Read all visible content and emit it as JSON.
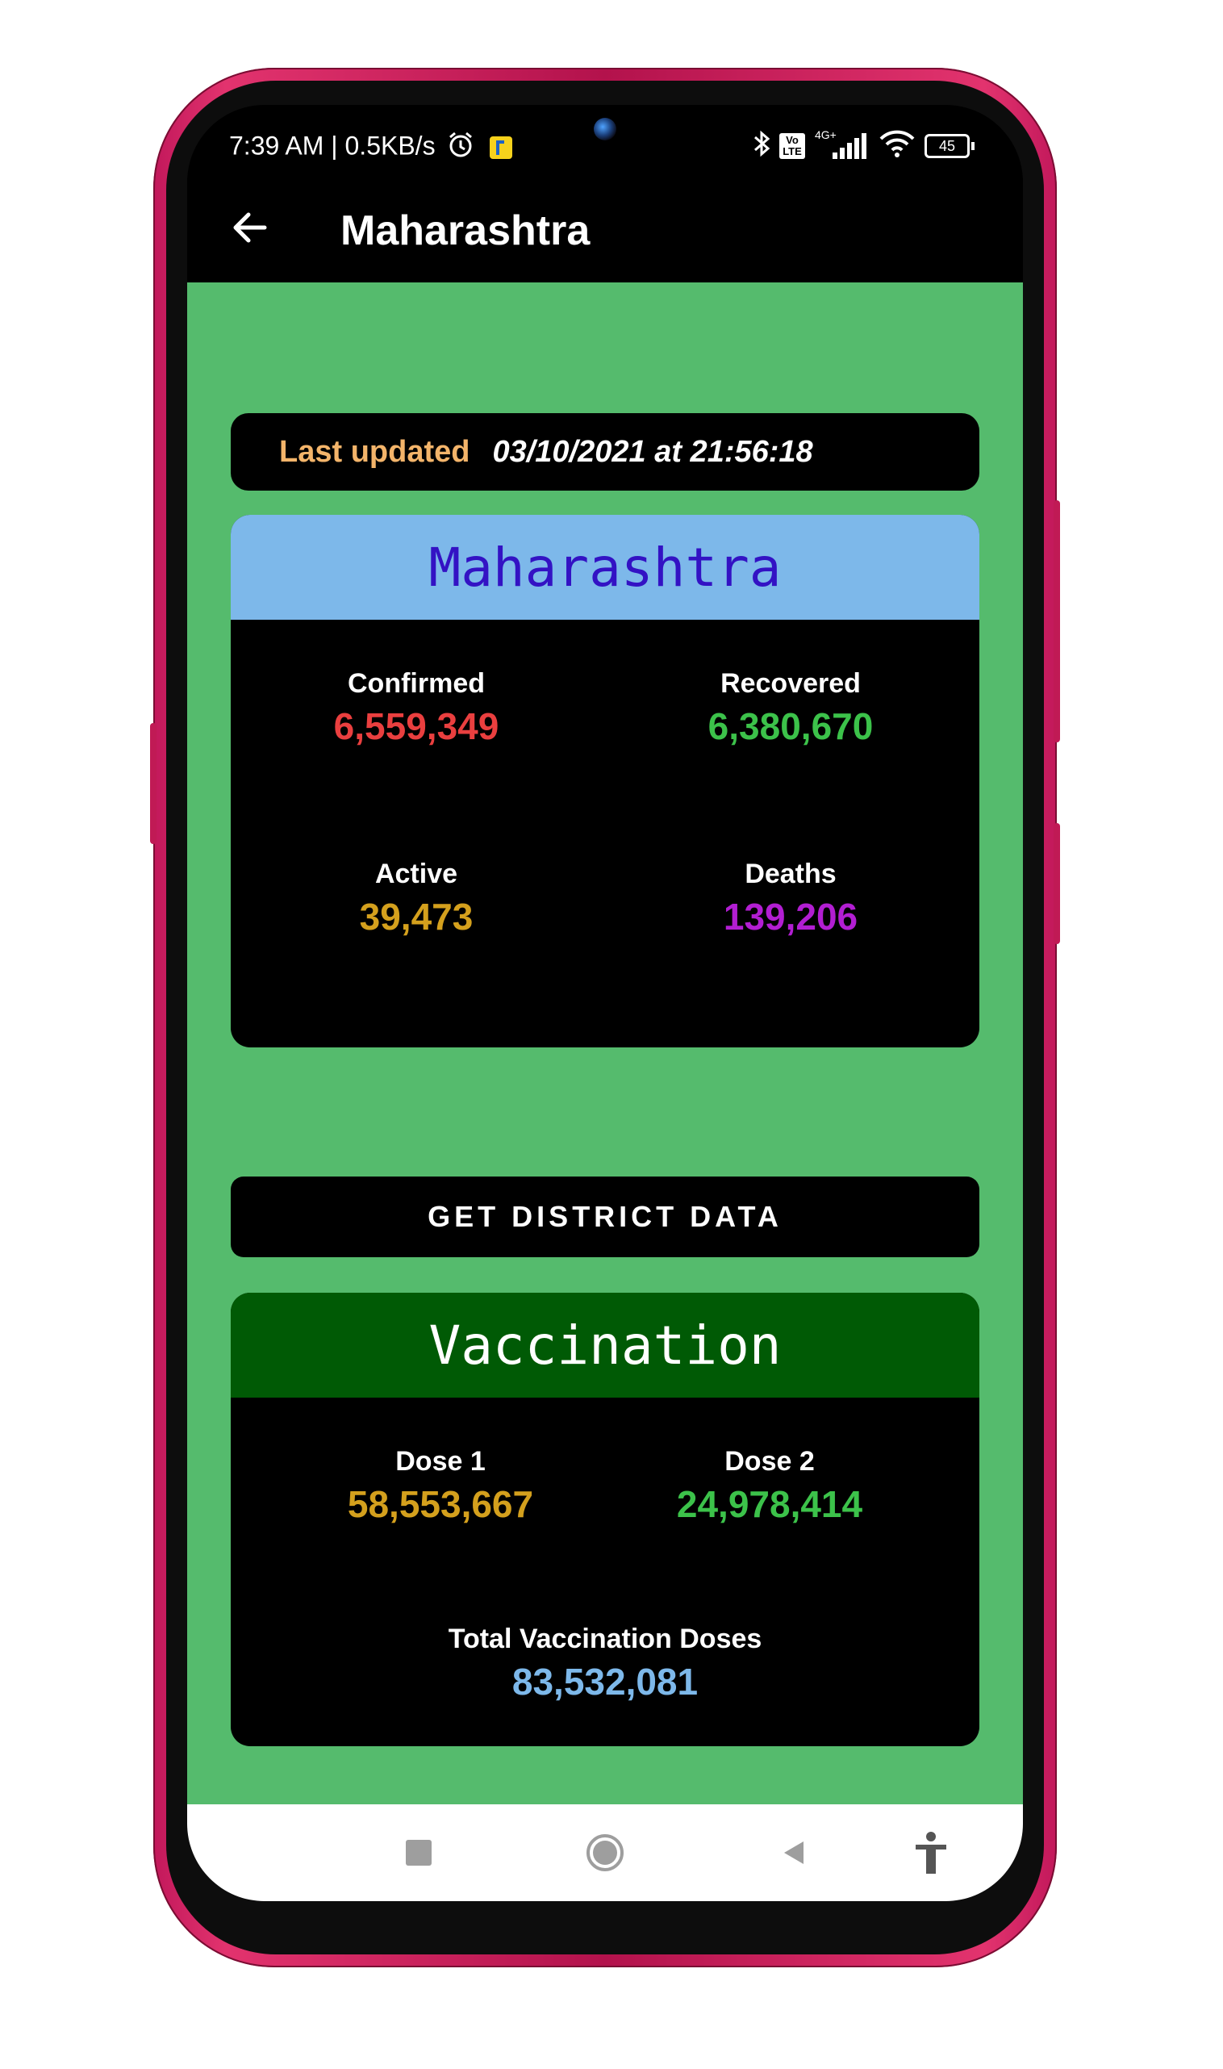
{
  "status_bar": {
    "time_speed": "7:39 AM | 0.5KB/s",
    "network": "4G+",
    "volte": "Vo LTE",
    "battery": "45"
  },
  "app_bar": {
    "title": "Maharashtra"
  },
  "last_updated": {
    "label": "Last updated",
    "value": "03/10/2021 at 21:56:18"
  },
  "state_card": {
    "title": "Maharashtra",
    "header_color": "#7db8ea",
    "title_color": "#3312c4",
    "stats": [
      {
        "label": "Confirmed",
        "value": "6,559,349",
        "color": "#ea3f3f"
      },
      {
        "label": "Recovered",
        "value": "6,380,670",
        "color": "#3cc24a"
      },
      {
        "label": "Active",
        "value": "39,473",
        "color": "#d4a01d"
      },
      {
        "label": "Deaths",
        "value": "139,206",
        "color": "#b21ed2"
      }
    ]
  },
  "district_button": {
    "label": "GET DISTRICT DATA"
  },
  "vaccination_card": {
    "title": "Vaccination",
    "header_color": "#005a05",
    "dose1": {
      "label": "Dose 1",
      "value": "58,553,667",
      "color": "#d4a01d"
    },
    "dose2": {
      "label": "Dose 2",
      "value": "24,978,414",
      "color": "#3cc24a"
    },
    "total": {
      "label": "Total Vaccination Doses",
      "value": "83,532,081",
      "color": "#7db8ea"
    }
  },
  "nav_bar": {
    "icons": [
      "recents-square-icon",
      "home-circle-icon",
      "back-triangle-icon",
      "accessibility-icon"
    ]
  }
}
